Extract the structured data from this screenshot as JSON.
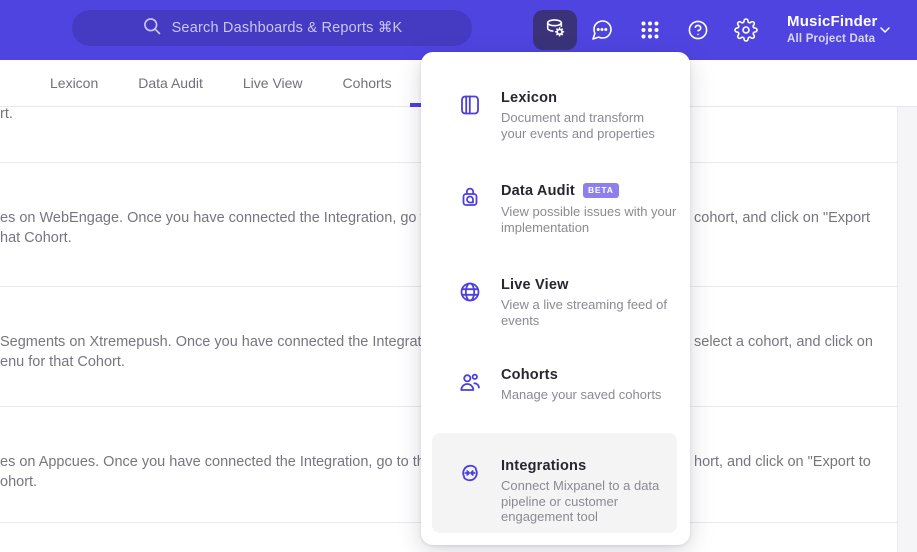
{
  "colors": {
    "header_bg": "#4f44e0",
    "search_pill_bg": "#453bc2",
    "active_icon_button_bg": "#3a3379",
    "accent": "#4c3fe0",
    "beta_badge_bg": "#8d80ec",
    "menu_highlight_bg": "#f4f4f5",
    "menu_title_text": "#27272f",
    "menu_description_text": "#8a8a92",
    "body_text": "#76767f"
  },
  "header": {
    "search_placeholder": "Search Dashboards & Reports ⌘K",
    "project_name": "MusicFinder",
    "project_scope": "All Project Data"
  },
  "tabs": {
    "items": [
      {
        "label": "Lexicon"
      },
      {
        "label": "Data Audit"
      },
      {
        "label": "Live View"
      },
      {
        "label": "Cohorts"
      }
    ]
  },
  "menu": {
    "items": [
      {
        "title": "Lexicon",
        "description": "Document and transform your events and properties"
      },
      {
        "title": "Data Audit",
        "badge": "BETA",
        "description": "View possible issues with your implementation"
      },
      {
        "title": "Live View",
        "description": "View a live streaming feed of events"
      },
      {
        "title": "Cohorts",
        "description": "Manage your saved cohorts"
      },
      {
        "title": "Integrations",
        "description": "Connect Mixpanel to a data pipeline or customer engagement tool"
      }
    ]
  },
  "content_rows": [
    {
      "line1_left": "rt."
    },
    {
      "line1_left": "es on WebEngage. Once you have connected the Integration, go to the",
      "line1_right": "cohort, and click on \"Export",
      "line2_left": "hat Cohort."
    },
    {
      "line1_left": "Segments on Xtremepush. Once you have connected the Integration,",
      "line1_right": "select a cohort, and click on",
      "line2_left": "enu for that Cohort."
    },
    {
      "line1_left": "es on Appcues. Once you have connected the Integration, go to the M",
      "line1_right": "hort, and click on \"Export to",
      "line2_left": "ohort."
    }
  ]
}
